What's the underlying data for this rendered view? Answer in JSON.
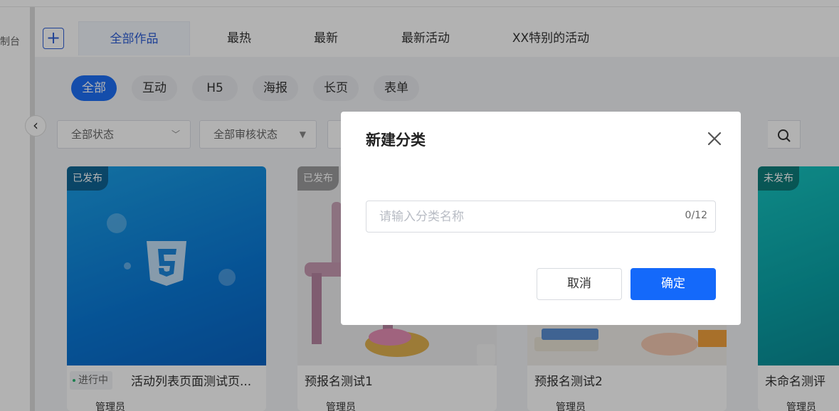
{
  "sidebar": {
    "partial_label": "制台"
  },
  "tabs": [
    {
      "label": "全部作品",
      "active": true
    },
    {
      "label": "最热"
    },
    {
      "label": "最新"
    },
    {
      "label": "最新活动"
    },
    {
      "label": "XX特别的活动"
    }
  ],
  "add_button": {
    "label": "+"
  },
  "chips": [
    "全部",
    "互动",
    "H5",
    "海报",
    "长页",
    "表单"
  ],
  "filters": {
    "status": "全部状态",
    "review": "全部审核状态"
  },
  "cards": [
    {
      "status": "已发布",
      "badge": "进行中",
      "title": "活动列表页面测试页...",
      "owner": "管理员"
    },
    {
      "status": "已发布",
      "title": "预报名测试1",
      "owner": "管理员"
    },
    {
      "title": "预报名测试2",
      "owner": "管理员"
    },
    {
      "status": "未发布",
      "title": "未命名测评",
      "owner": "管理员"
    }
  ],
  "modal": {
    "title": "新建分类",
    "input_placeholder": "请输入分类名称",
    "counter": "0/12",
    "cancel_label": "取消",
    "confirm_label": "确定"
  },
  "icons": {
    "close": "close-icon",
    "search": "search-icon",
    "back": "chevron-left-icon",
    "html5": "html5-icon"
  },
  "colors": {
    "primary": "#1469fa",
    "chip_active": "#1e6ff5",
    "tab_active_text": "#2f5fd6"
  }
}
